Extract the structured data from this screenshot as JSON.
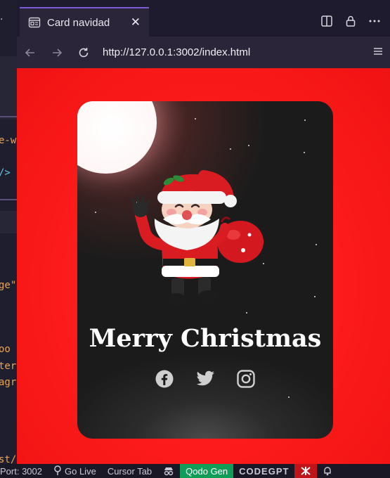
{
  "editor": {
    "code_lines": [
      "e-w",
      "/>",
      "ge\"",
      "oo",
      "ter",
      "agr",
      "st/"
    ]
  },
  "tab": {
    "icon": "preview-icon",
    "label": "Card navidad",
    "close_label": "✕"
  },
  "tab_actions": [
    "split-editor-icon",
    "lock-icon",
    "more-icon"
  ],
  "navbar": {
    "url": "http://127.0.0.1:3002/index.html"
  },
  "card": {
    "title": "Merry Christmas",
    "socials": [
      "facebook-icon",
      "twitter-icon",
      "instagram-icon"
    ]
  },
  "statusbar": {
    "port": "Port: 3002",
    "go_live": "Go Live",
    "cursor_tab": "Cursor Tab",
    "qodo": "Qodo Gen",
    "codegpt": "CODEGPT"
  },
  "colors": {
    "background_red": "#ff1c1c",
    "card_bg": "#1b1b1b",
    "tab_accent": "#7b5cd6",
    "status_green": "#0f9d58",
    "status_red": "#c0141b"
  }
}
